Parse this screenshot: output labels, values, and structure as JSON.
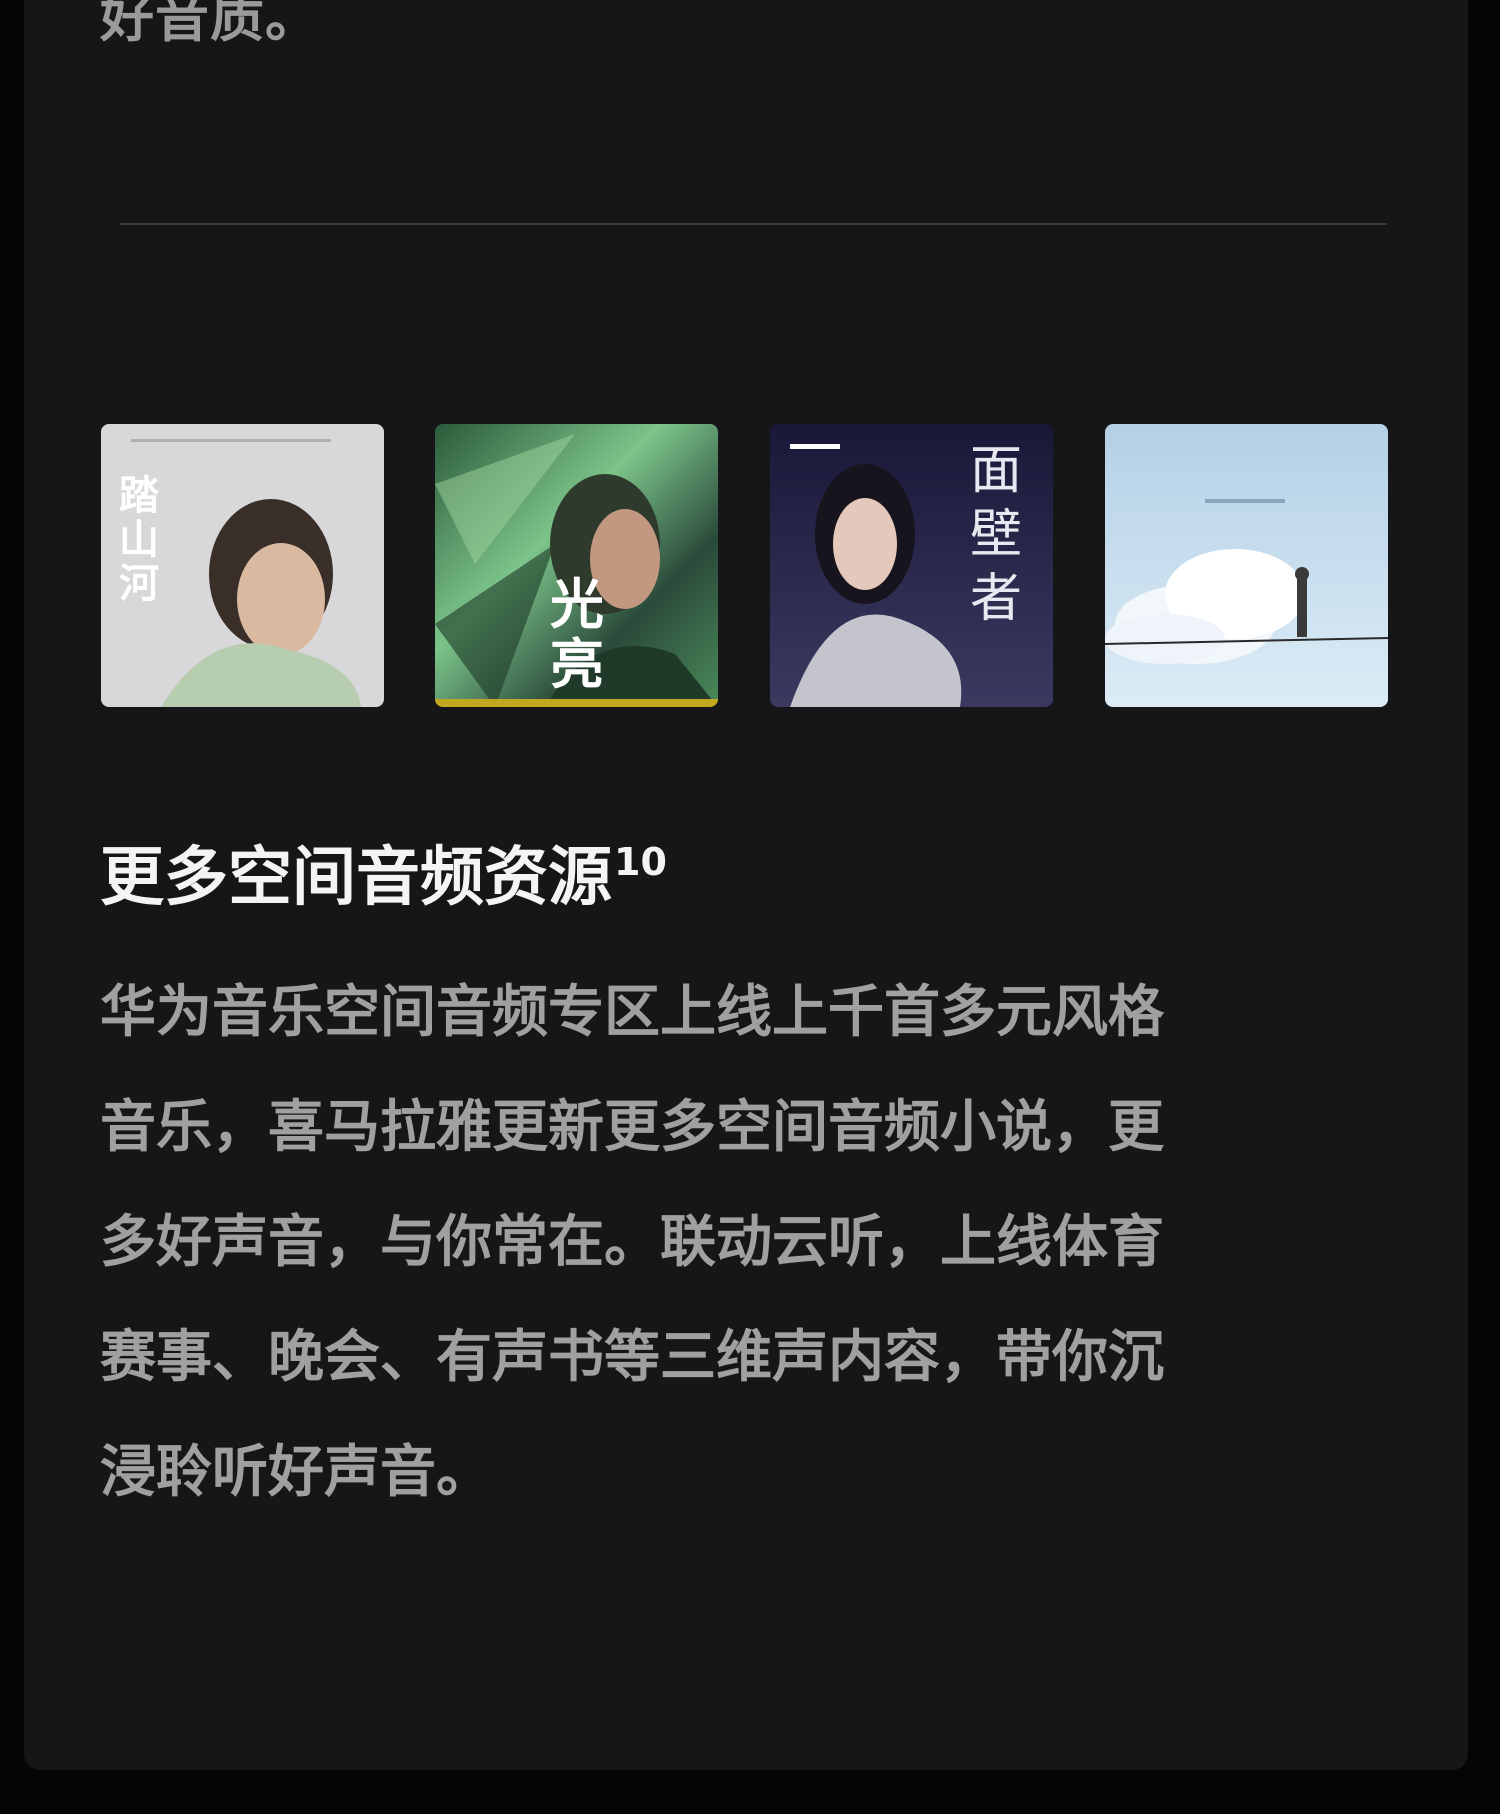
{
  "intro": {
    "tail_text": "好音质。"
  },
  "albums": [
    {
      "name": "album-cover-1",
      "cover_text": "踏山河",
      "colors": [
        "#d9d9db",
        "#b8c8b0"
      ]
    },
    {
      "name": "album-cover-2",
      "cover_text": "光亮",
      "colors": [
        "#1f4a2e",
        "#7ec07a"
      ]
    },
    {
      "name": "album-cover-3",
      "cover_text": "面壁者",
      "colors": [
        "#1b1a3a",
        "#4a4a7a"
      ]
    },
    {
      "name": "album-cover-4",
      "cover_text": "",
      "colors": [
        "#b9d4e8",
        "#e6f1f8"
      ]
    }
  ],
  "section": {
    "title": "更多空间音频资源",
    "footnote": "10",
    "body_lines": [
      "华为音乐空间音频专区上线上千首多元风格",
      "音乐，喜马拉雅更新更多空间音频小说，更",
      "多好声音，与你常在。联动云听，上线体育",
      "赛事、晚会、有声书等三维声内容，带你沉",
      "浸聆听好声音。"
    ]
  }
}
